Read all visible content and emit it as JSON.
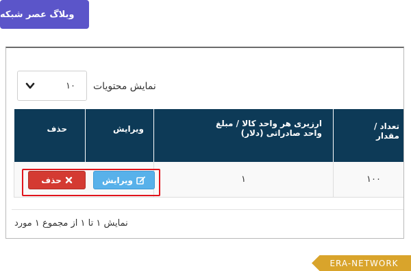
{
  "blog_badge": "وبلاگ عصر شبکه",
  "length_menu": {
    "label": "نمایش محتویات",
    "selected": "۱۰"
  },
  "table": {
    "headers": {
      "quantity": [
        "تعداد /",
        "مقدار"
      ],
      "value": [
        "ارزیری هر واحد کالا / مبلغ",
        "واحد صادراتی (دلار)"
      ],
      "edit": "ویرایش",
      "delete": "حذف"
    },
    "row": {
      "quantity": "۱۰۰",
      "value": "۱",
      "edit_button": "ویرایش",
      "delete_button": "حذف"
    }
  },
  "info_text": "نمایش ۱ تا ۱ از مجموع ۱ مورد",
  "watermark": "ERA-NETWORK",
  "colors": {
    "header_bg": "#0d3a57",
    "delete_btn": "#d43a32",
    "edit_btn": "#58b1ea",
    "badge_bg": "#5b55c9",
    "highlight": "#e0141b",
    "watermark_bg": "#d9a42b"
  },
  "icons": {
    "select": "chevron-down-icon",
    "edit": "edit-icon",
    "delete": "close-icon"
  }
}
